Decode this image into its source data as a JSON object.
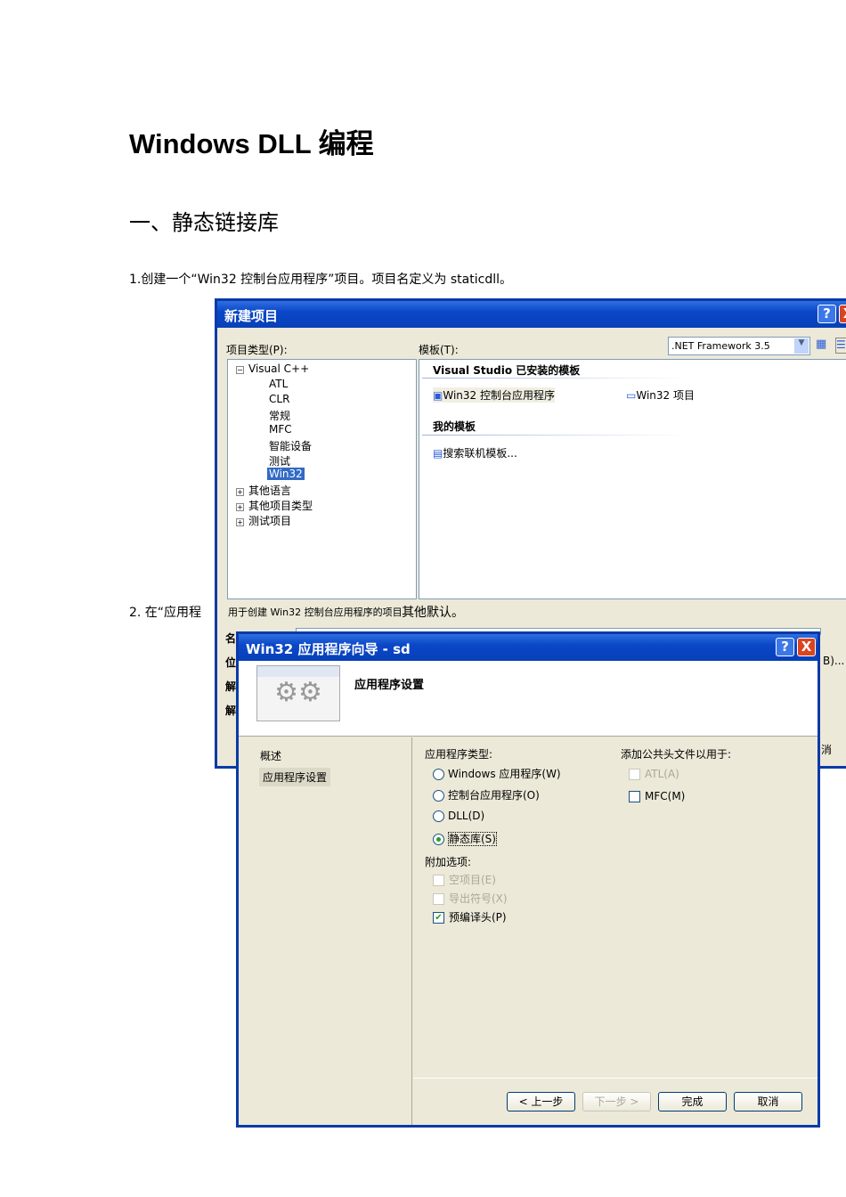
{
  "doc": {
    "title": "Windows DLL  编程",
    "section": "一、静态链接库",
    "step1": "1.创建一个“Win32  控制台应用程序”项目。项目名定义为 staticdll。",
    "step2_a": "2.  在“应用程",
    "step2_b": "其他默认。"
  },
  "new_project": {
    "title": "新建项目",
    "help": "?",
    "close": "X",
    "types_label": "项目类型(P):",
    "templates_label": "模板(T):",
    "framework": ".NET Framework 3.5",
    "tree": [
      "Visual C++",
      "ATL",
      "CLR",
      "常规",
      "MFC",
      "智能设备",
      "测试",
      "Win32",
      "其他语言",
      "其他项目类型",
      "测试项目"
    ],
    "installed_heading": "Visual Studio 已安装的模板",
    "templates": [
      "Win32 控制台应用程序",
      "Win32 项目"
    ],
    "my_heading": "我的模板",
    "search": "搜索联机模板...",
    "status": "用于创建 Win32 控制台应用程序的项目",
    "labels": [
      "名",
      "位",
      "解",
      "解"
    ],
    "browse": "B)...",
    "cancel": "消"
  },
  "wizard": {
    "title": "Win32 应用程序向导 - sd",
    "help": "?",
    "close": "X",
    "heading": "应用程序设置",
    "nav": [
      "概述",
      "应用程序设置"
    ],
    "app_type_label": "应用程序类型:",
    "app_types": [
      "Windows 应用程序(W)",
      "控制台应用程序(O)",
      "DLL(D)",
      "静态库(S)"
    ],
    "extra_label": "附加选项:",
    "extras": [
      "空项目(E)",
      "导出符号(X)",
      "预编译头(P)"
    ],
    "headers_label": "添加公共头文件以用于:",
    "headers": [
      "ATL(A)",
      "MFC(M)"
    ],
    "buttons": [
      "< 上一步",
      "下一步 >",
      "完成",
      "取消"
    ]
  }
}
